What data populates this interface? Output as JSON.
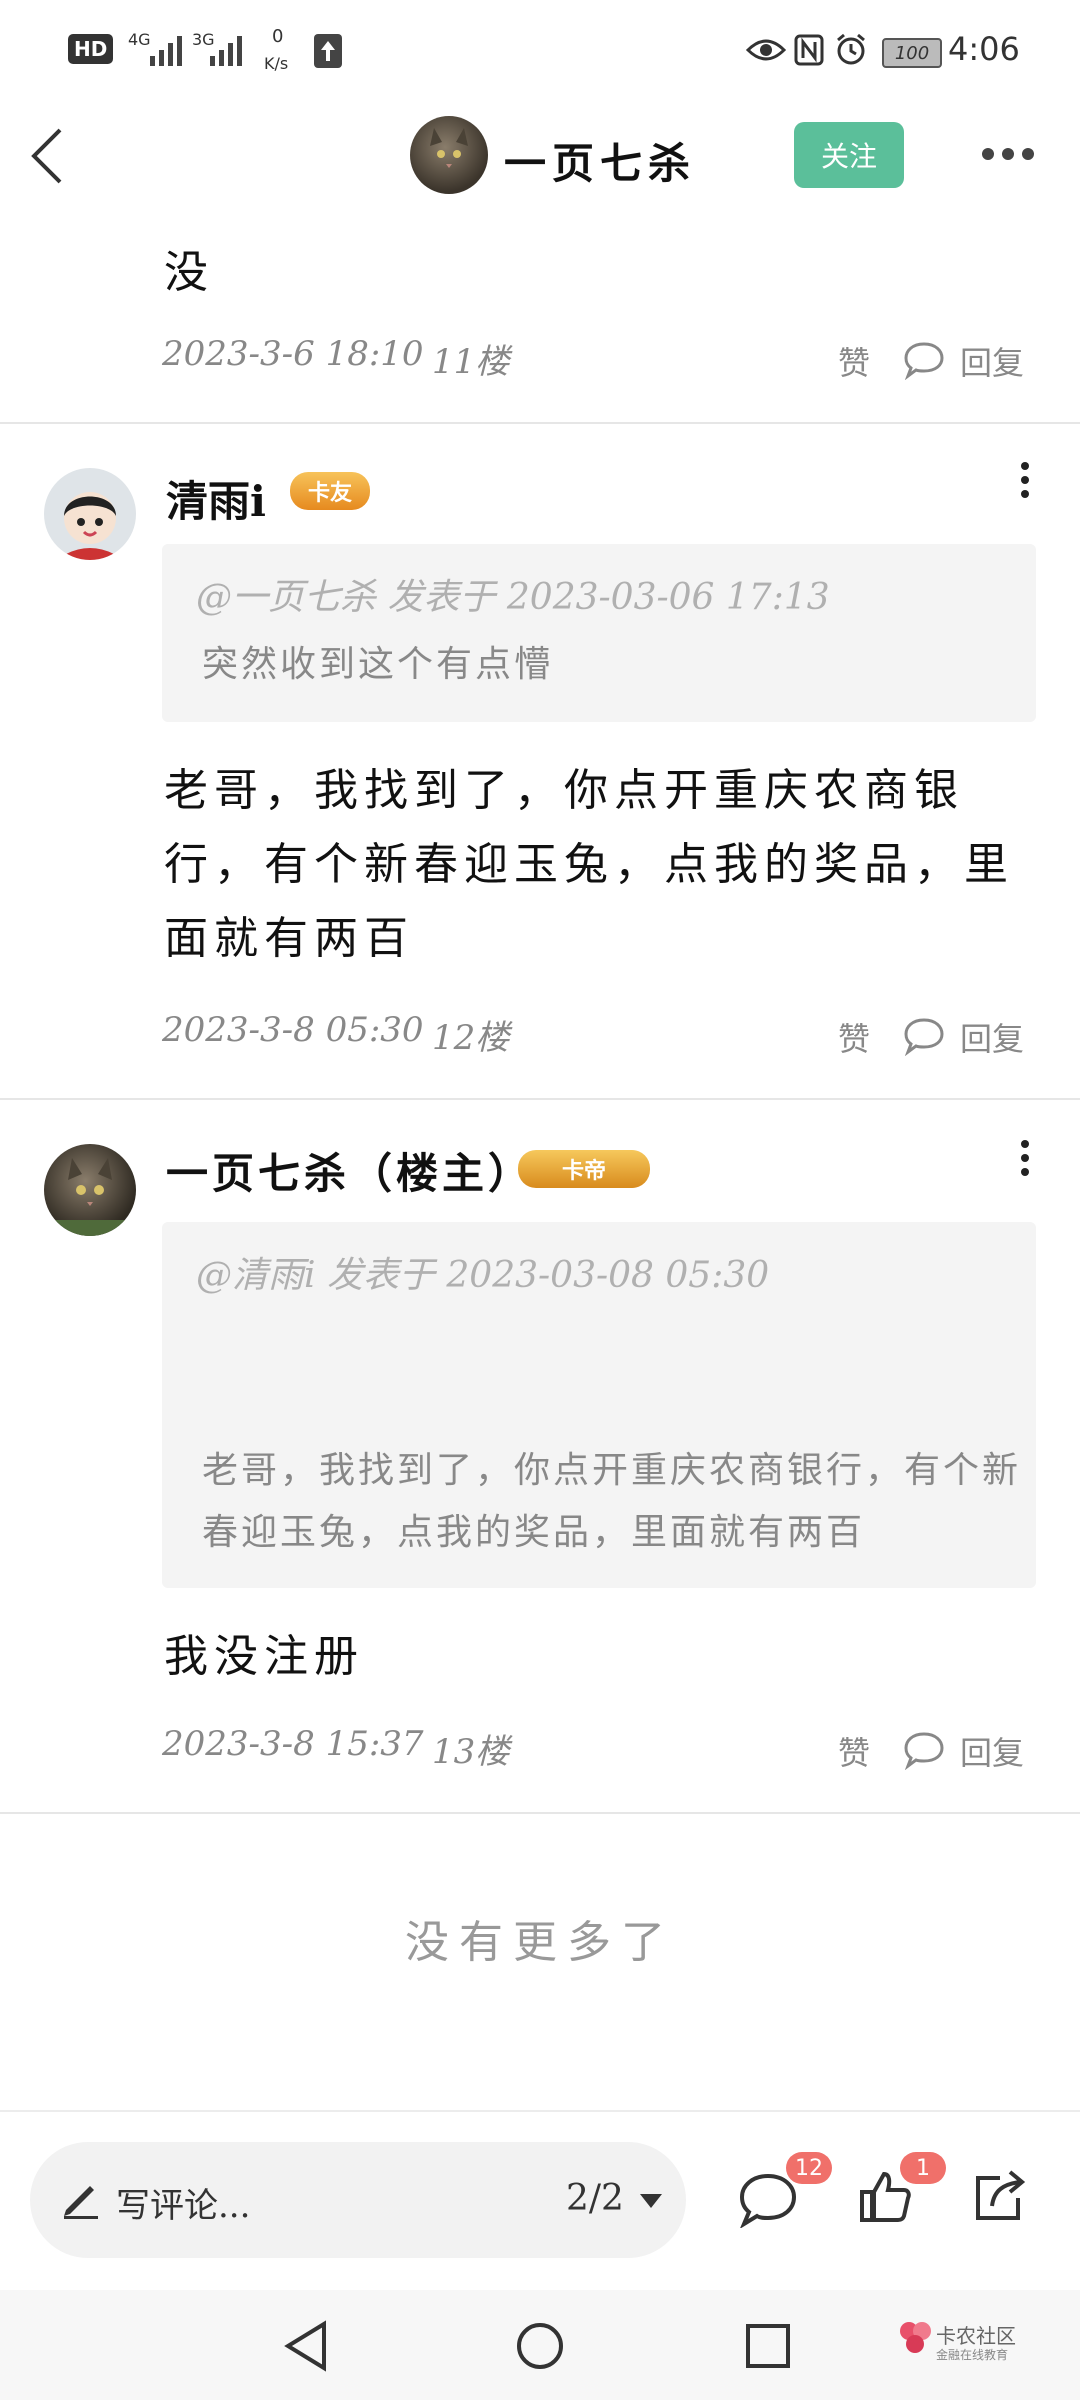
{
  "status_bar": {
    "network_left": "HD",
    "signal1": "4G",
    "signal2": "3G",
    "speed_value": "0",
    "speed_unit": "K/s",
    "battery": "100",
    "time": "4:06"
  },
  "header": {
    "author_name": "一页七杀",
    "follow_label": "关注"
  },
  "posts": [
    {
      "body": "没",
      "date": "2023-3-6 18:10",
      "floor": "11楼",
      "like_label": "赞",
      "reply_label": "回复"
    },
    {
      "user": "清雨i",
      "badge": "卡友",
      "quote_meta": "@一页七杀 发表于 2023-03-06 17:13",
      "quote_text": "突然收到这个有点懵",
      "body": "老哥，我找到了，你点开重庆农商银行，有个新春迎玉兔，点我的奖品，里面就有两百",
      "date": "2023-3-8 05:30",
      "floor": "12楼",
      "like_label": "赞",
      "reply_label": "回复"
    },
    {
      "user": "一页七杀（楼主）",
      "badge": "卡帝",
      "quote_meta": "@清雨i 发表于 2023-03-08 05:30",
      "quote_text": "老哥，我找到了，你点开重庆农商银行，有个新春迎玉兔，点我的奖品，里面就有两百",
      "body": "我没注册",
      "date": "2023-3-8 15:37",
      "floor": "13楼",
      "like_label": "赞",
      "reply_label": "回复"
    }
  ],
  "no_more": "没有更多了",
  "bottom_bar": {
    "comment_placeholder": "写评论...",
    "page_indicator": "2/2",
    "comment_count": "12",
    "like_count": "1"
  },
  "nav_bar": {
    "watermark_title": "卡农社区",
    "watermark_subtitle": "金融在线教育"
  },
  "colors": {
    "accent": "#5bbf9a",
    "badge_red": "#f0706a",
    "gold": "#f2b33b"
  }
}
